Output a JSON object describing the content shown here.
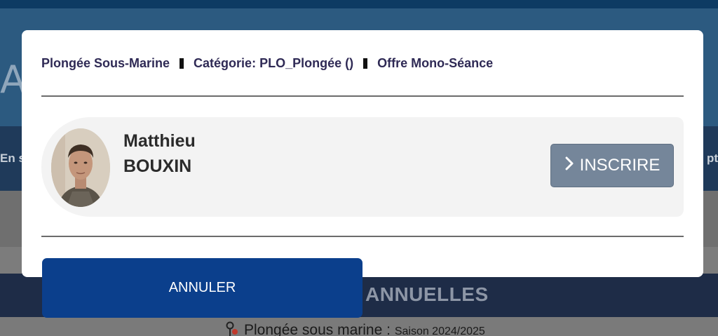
{
  "background": {
    "hero_letter": "A",
    "nav_left_text": "En s",
    "nav_right_text": "pt",
    "band_text": "ANNUELLES",
    "bottom_text": "Plongée sous marine :",
    "bottom_small_text": "Saison 2024/2025",
    "bottom_icon": "diving-pin-icon"
  },
  "modal": {
    "breadcrumb": [
      "Plongée Sous-Marine",
      "Catégorie: PLO_Plongée ()",
      "Offre Mono-Séance"
    ],
    "person": {
      "first_name": "Matthieu",
      "last_name": "BOUXIN",
      "photo": "avatar-photo"
    },
    "inscrire_label": "INSCRIRE",
    "inscrire_icon": "chevron-right-icon",
    "annuler_label": "ANNULER"
  },
  "colors": {
    "primary": "#0b3f8c",
    "secondary_button": "#75869a",
    "breadcrumb_text": "#2f2a55"
  }
}
